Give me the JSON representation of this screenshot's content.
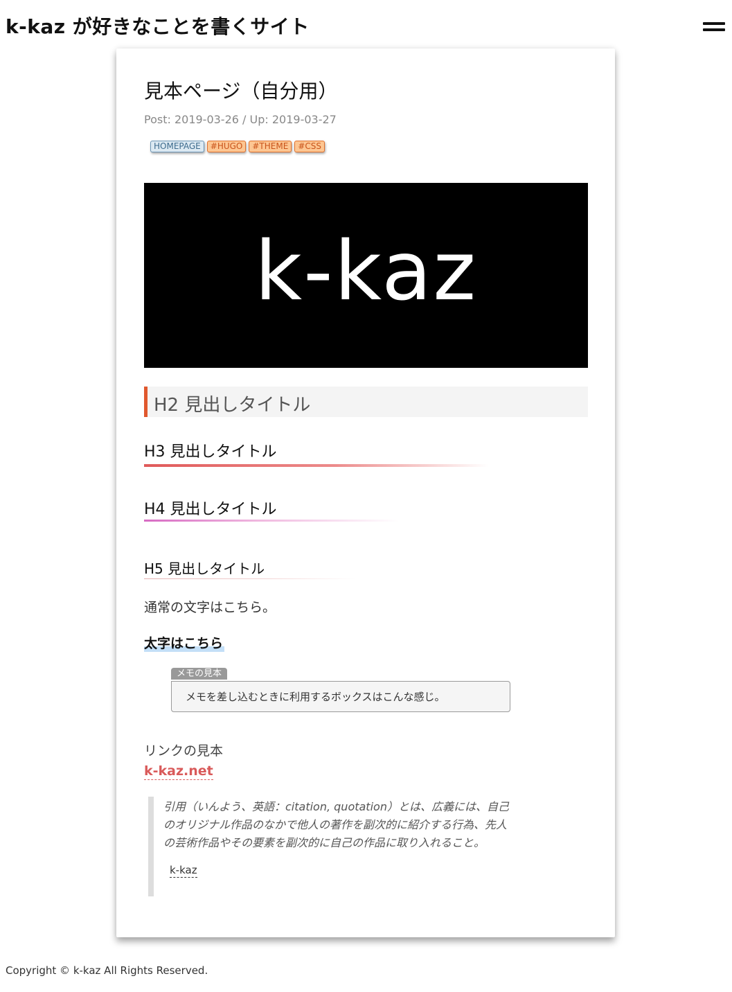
{
  "header": {
    "site_title": "k-kaz が好きなことを書くサイト",
    "menu_icon": "hamburger-icon"
  },
  "post": {
    "title": "見本ページ（自分用）",
    "dates": "Post: 2019-03-26 / Up: 2019-03-27",
    "category": "HOMEPAGE",
    "tags": [
      "#HUGO",
      "#THEME",
      "#CSS"
    ],
    "hero_text": "k-kaz"
  },
  "content": {
    "h2": "H2 見出しタイトル",
    "h3": "H3 見出しタイトル",
    "h4": "H4 見出しタイトル",
    "h5": "H5 見出しタイトル",
    "normal_text": "通常の文字はこちら。",
    "bold_text": "太字はこちら",
    "memo": {
      "label": "メモの見本",
      "text": "メモを差し込むときに利用するボックスはこんな感じ。"
    },
    "link_caption": "リンクの見本",
    "link_text": "k-kaz.net",
    "quote": {
      "text": "引用（いんよう、英語：citation, quotation）とは、広義には、自己のオリジナル作品のなかで他人の著作を副次的に紹介する行為、先人の芸術作品やその要素を副次的に自己の作品に取り入れること。",
      "source": "k-kaz"
    }
  },
  "footer": {
    "copyright": "Copyright © k-kaz All Rights Reserved."
  },
  "colors": {
    "accent_red": "#e0582e",
    "link_red": "#d95a5a",
    "tag_orange": "#fdc692",
    "category_blue": "#dce9f2"
  }
}
